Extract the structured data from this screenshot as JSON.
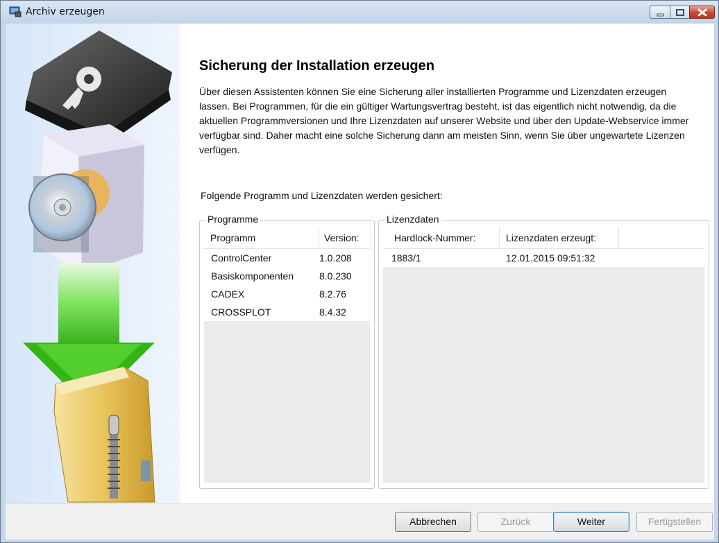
{
  "window": {
    "title": "Archiv erzeugen"
  },
  "page": {
    "heading": "Sicherung der Installation erzeugen",
    "description": "Über diesen Assistenten können Sie eine Sicherung aller installierten Programme und Lizenzdaten erzeugen lassen. Bei Programmen, für die ein gültiger Wartungsvertrag besteht, ist das eigentlich nicht notwendig, da die aktuellen Programmversionen und Ihre Lizenzdaten auf unserer Website und über den Update-Webservice immer verfügbar sind. Daher macht eine solche Sicherung dann am meisten Sinn, wenn Sie über ungewartete Lizenzen verfügen.",
    "section_label": "Folgende Programm und Lizenzdaten werden gesichert:"
  },
  "programs": {
    "group_title": "Programme",
    "columns": [
      "Programm",
      "Version:"
    ],
    "rows": [
      {
        "name": "ControlCenter",
        "version": "1.0.208"
      },
      {
        "name": "Basiskomponenten",
        "version": "8.0.230"
      },
      {
        "name": "CADEX",
        "version": "8.2.76"
      },
      {
        "name": "CROSSPLOT",
        "version": "8.4.32"
      }
    ]
  },
  "licenses": {
    "group_title": "Lizenzdaten",
    "columns": [
      "Hardlock-Nummer:",
      "Lizenzdaten erzeugt:"
    ],
    "rows": [
      {
        "hardlock": "1883/1",
        "created": "12.01.2015 09:51:32"
      }
    ]
  },
  "buttons": {
    "cancel": "Abbrechen",
    "back": "Zurück",
    "next": "Weiter",
    "finish": "Fertigstellen"
  },
  "colors": {
    "sidebar_bg": "#d7e7f8",
    "arrow_green": "#3cc21c",
    "close_button": "#c74a36"
  }
}
